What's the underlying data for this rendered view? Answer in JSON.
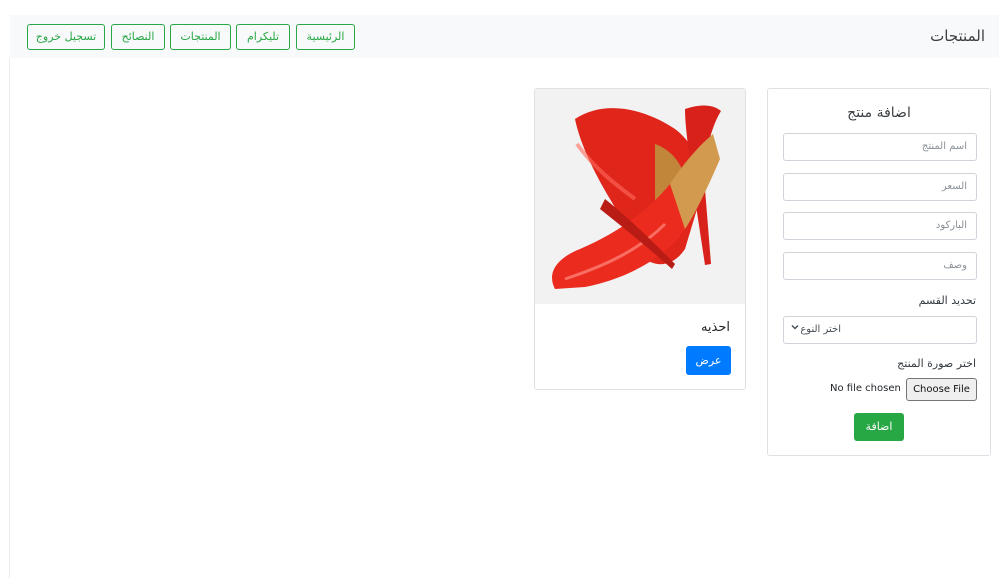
{
  "navbar": {
    "brand": "المنتجات",
    "links": [
      "الرئيسية",
      "تليكرام",
      "المنتجات",
      "النصائح",
      "تسجيل خروج"
    ]
  },
  "form": {
    "title": "اضافة منتج",
    "name_placeholder": "اسم المنتج",
    "price_placeholder": "السعر",
    "barcode_placeholder": "الباركود",
    "description_placeholder": "وصف",
    "category_label": "تحديد القسم",
    "category_selected": "اختر النوع",
    "image_label": "اختر صورة المنتج",
    "file_status": "No file chosen",
    "file_button": "Choose File",
    "submit_label": "اضافة"
  },
  "product": {
    "name": "احذيه",
    "view_label": "عرض",
    "image_icon": "red-high-heel-shoe"
  },
  "colors": {
    "success": "#28a745",
    "primary": "#007bff",
    "navbar_bg": "#f8f9fa"
  }
}
